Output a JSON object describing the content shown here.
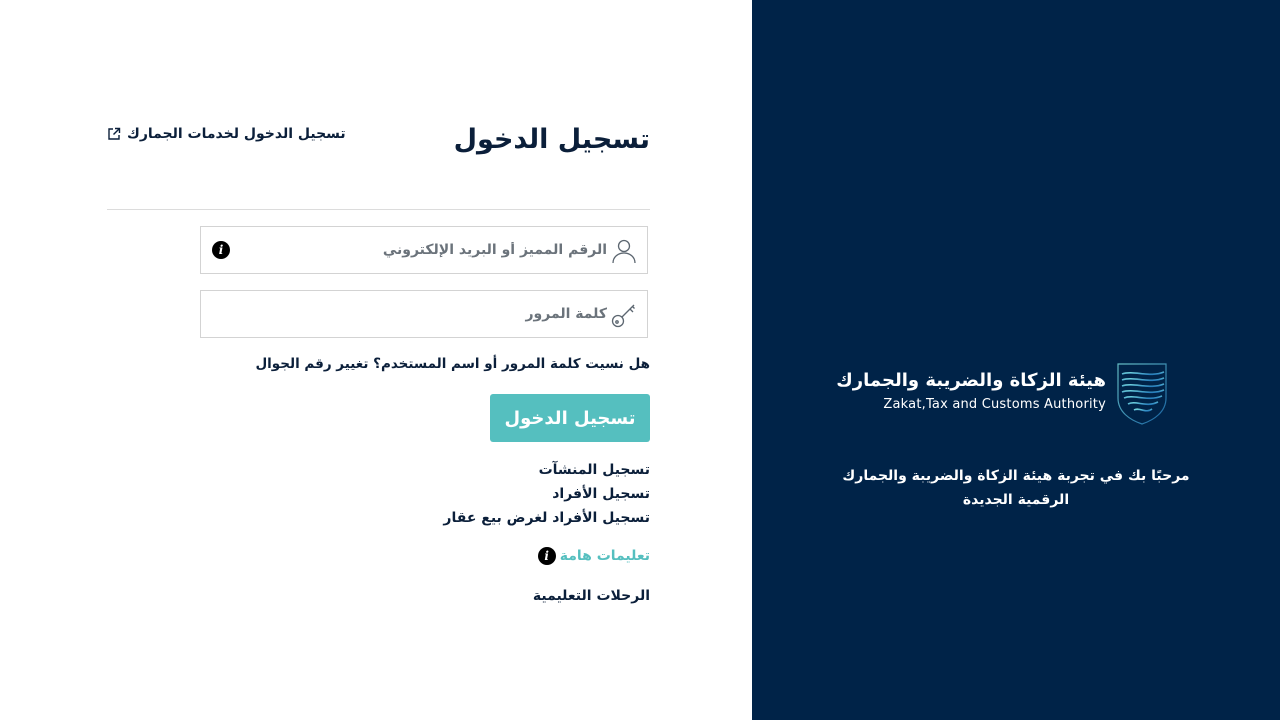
{
  "login": {
    "title": "تسجيل الدخول",
    "customs_link": "تسجيل الدخول لخدمات الجمارك",
    "username_placeholder": "الرقم المميز أو البريد الإلكتروني",
    "password_placeholder": "كلمة المرور",
    "forgot_text": "هل نسيت كلمة المرور أو اسم المستخدم؟",
    "change_mobile": "تغيير رقم الجوال",
    "login_button": "تسجيل الدخول",
    "register_links": [
      "تسجيل المنشآت",
      "تسجيل الأفراد",
      "تسجيل الأفراد لغرض بيع عقار"
    ],
    "important_instructions": "تعليمات هامة",
    "learning_journeys": "الرحلات التعليمية",
    "info_glyph": "i"
  },
  "brand": {
    "name_ar": "هيئة الزكاة والضريبة والجمارك",
    "name_en": "Zakat,Tax and Customs Authority",
    "welcome": "مرحبًا بك في تجربة هيئة الزكاة والضريبة والجمارك الرقمية الجديدة"
  },
  "icons": {
    "user": "user-icon",
    "key": "key-icon",
    "info": "info-icon",
    "external": "external-link-icon",
    "emblem": "zatca-emblem-icon"
  },
  "colors": {
    "navy": "#002348",
    "teal": "#55bfbf",
    "text": "#0b1f3a"
  }
}
